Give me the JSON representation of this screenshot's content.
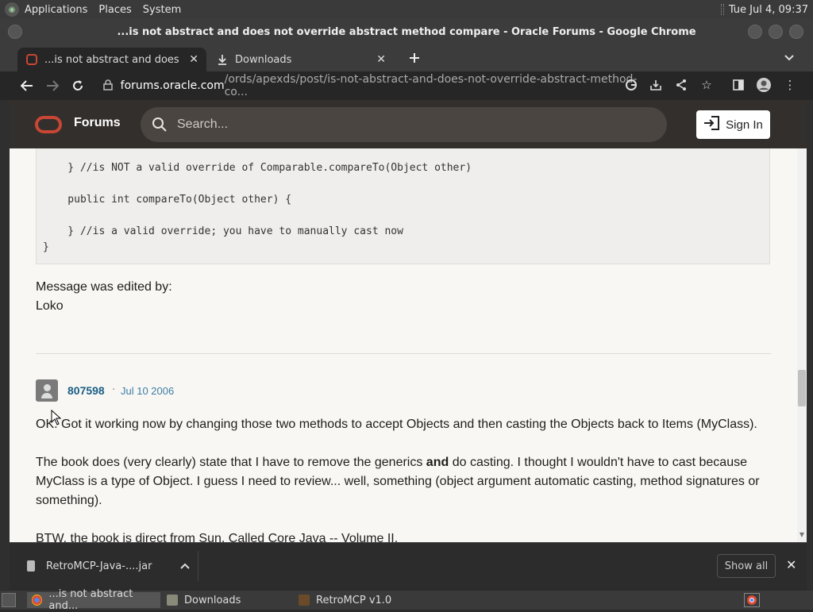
{
  "panel": {
    "menus": [
      "Applications",
      "Places",
      "System"
    ],
    "clock": "Tue Jul  4, 09:37"
  },
  "window": {
    "title": "...is not abstract and does not override abstract method compare - Oracle Forums - Google Chrome"
  },
  "tabs": [
    {
      "label": "...is not abstract and does not o",
      "active": true,
      "icon": "oracle-favicon"
    },
    {
      "label": "Downloads",
      "active": false,
      "icon": "download-icon"
    }
  ],
  "address_bar": {
    "url_host": "forums.oracle.com",
    "url_path": "/ords/apexds/post/is-not-abstract-and-does-not-override-abstract-method-co..."
  },
  "forum_header": {
    "site_name": "Forums",
    "search_placeholder": "Search...",
    "signin_label": "Sign In",
    "brand_color": "#c74634"
  },
  "code_lines": [
    "    } //is NOT a valid override of Comparable.compareTo(Object other)",
    "",
    "    public int compareTo(Object other) {",
    "",
    "    } //is a valid override; you have to manually cast now",
    "}"
  ],
  "edit_note": {
    "line1": "Message was edited by:",
    "line2": "Loko"
  },
  "post": {
    "author": "807598",
    "separator": "·",
    "date": "Jul 10 2006",
    "para1": "OK. Got it working now by changing those two methods to accept Objects and then casting the Objects back to Items (MyClass).",
    "para2_before": "The book does (very clearly) state that I have to remove the generics ",
    "para2_bold": "and",
    "para2_after": " do casting. I thought I wouldn't have to cast because MyClass is a type of Object. I guess I need to review... well, something (object argument automatic casting, method signatures or something).",
    "para3": "BTW, the book is direct from Sun. Called Core Java -- Volume II."
  },
  "download_shelf": {
    "file_name": "RetroMCP-Java-....jar",
    "show_all": "Show all"
  },
  "taskbar": {
    "tasks": [
      "...is not abstract and...",
      "Downloads",
      "RetroMCP v1.0"
    ]
  }
}
